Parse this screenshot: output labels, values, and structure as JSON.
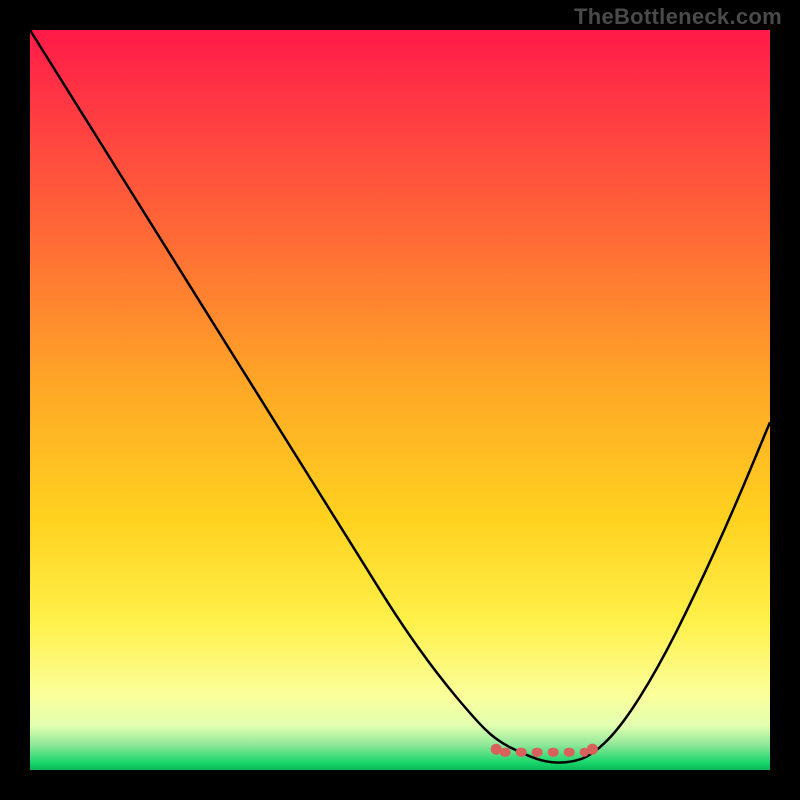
{
  "watermark": "TheBottleneck.com",
  "chart_data": {
    "type": "line",
    "title": "",
    "xlabel": "",
    "ylabel": "",
    "xlim": [
      0,
      100
    ],
    "ylim": [
      0,
      100
    ],
    "grid": false,
    "legend": false,
    "series": [
      {
        "name": "bottleneck-curve",
        "x": [
          0,
          5,
          10,
          15,
          20,
          25,
          30,
          35,
          40,
          45,
          50,
          55,
          60,
          63,
          67,
          70,
          73,
          76,
          80,
          85,
          90,
          95,
          100
        ],
        "values": [
          100,
          92,
          84,
          76,
          68,
          60,
          52,
          44,
          36,
          28,
          20,
          13,
          7,
          4,
          2,
          1,
          1,
          2,
          6,
          14,
          24,
          35,
          47
        ]
      }
    ],
    "trough": {
      "x_range": [
        63,
        76
      ],
      "y": 2,
      "color": "#d9615c"
    },
    "background_gradient": {
      "stops": [
        {
          "pos": 0.0,
          "color": "#ff1a49"
        },
        {
          "pos": 0.28,
          "color": "#ff6a36"
        },
        {
          "pos": 0.66,
          "color": "#ffd21f"
        },
        {
          "pos": 0.9,
          "color": "#fbff9c"
        },
        {
          "pos": 0.97,
          "color": "#4fdc7e"
        },
        {
          "pos": 1.0,
          "color": "#0bb85b"
        }
      ]
    }
  }
}
